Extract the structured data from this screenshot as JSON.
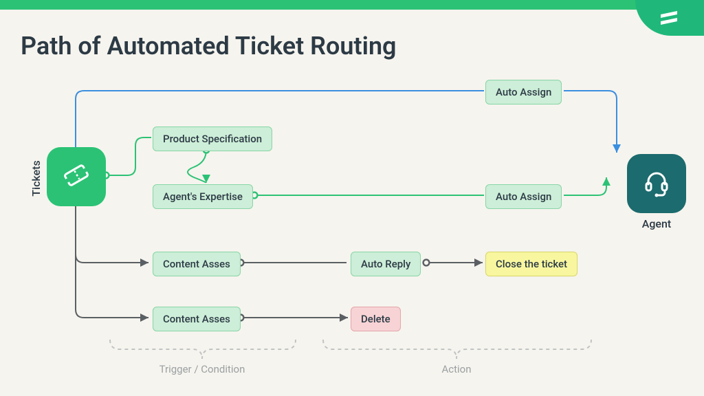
{
  "title": "Path of Automated Ticket Routing",
  "nodes": {
    "tickets_label": "Tickets",
    "agent_label": "Agent",
    "product_spec": "Product Specification",
    "agent_expertise": "Agent's Expertise",
    "content_asses_1": "Content Asses",
    "content_asses_2": "Content Asses",
    "auto_assign_top": "Auto Assign",
    "auto_assign_mid": "Auto Assign",
    "auto_reply": "Auto Reply",
    "close_ticket": "Close the ticket",
    "delete": "Delete"
  },
  "groups": {
    "trigger_condition": "Trigger / Condition",
    "action": "Action"
  },
  "colors": {
    "brand_green": "#2bc275",
    "agent_teal": "#1c6b6e",
    "node_green_bg": "#cdeed8",
    "node_yellow_bg": "#f8f79f",
    "node_pink_bg": "#f7d3d5"
  },
  "icons": {
    "ticket": "ticket-icon",
    "agent": "headset-icon",
    "brand": "brand-swoosh-icon"
  }
}
